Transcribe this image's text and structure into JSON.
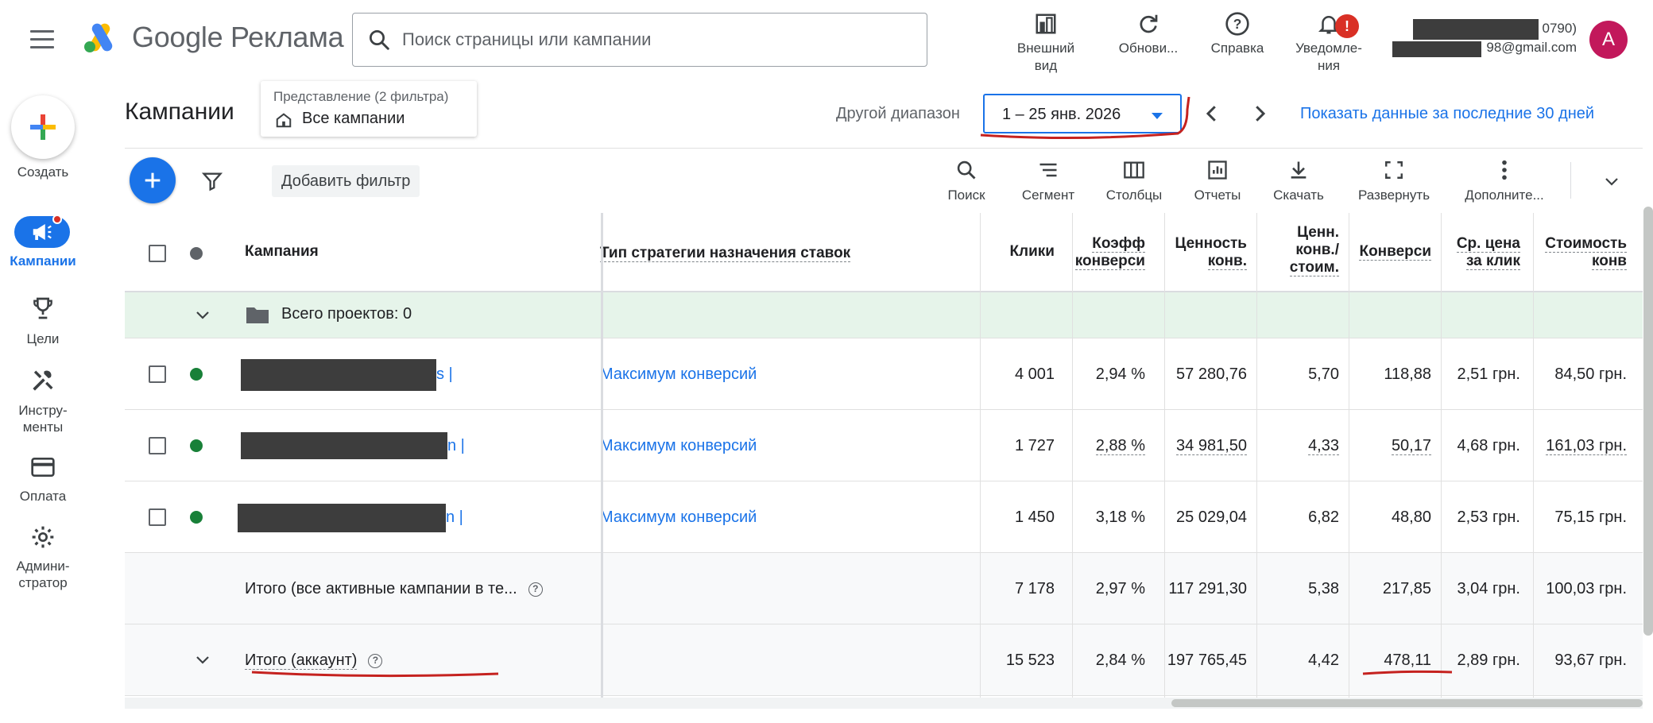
{
  "app": {
    "name": "Google Реклама",
    "search_placeholder": "Поиск страницы или кампании"
  },
  "top_actions": [
    {
      "label": "Внешний вид"
    },
    {
      "label": "Обнови..."
    },
    {
      "label": "Справка"
    },
    {
      "label": "Уведомле-ния",
      "badge": "!"
    }
  ],
  "account": {
    "id_tail": "0790)",
    "email_tail": "98@gmail.com",
    "avatar_letter": "A"
  },
  "rail": {
    "create": "Создать",
    "campaigns": "Кампании",
    "goals": "Цели",
    "tools": "Инстру-менты",
    "billing": "Оплата",
    "admin": "Админи-стратор"
  },
  "header": {
    "title": "Кампании",
    "view_label": "Представление (2 фильтра)",
    "view_value": "Все кампании",
    "range_label": "Другой диапазон",
    "date_range": "1 – 25 янв. 2026",
    "last30": "Показать данные за последние 30 дней"
  },
  "toolbar": {
    "add_filter": "Добавить фильтр",
    "tools": [
      "Поиск",
      "Сегмент",
      "Столбцы",
      "Отчеты",
      "Скачать",
      "Развернуть",
      "Дополните..."
    ]
  },
  "table": {
    "columns": {
      "campaign": "Кампания",
      "strategy": "Тип стратегии назначения ставок",
      "clicks": "Клики",
      "conv_rate_l1": "Коэфф",
      "conv_rate_l2": "конверси",
      "conv_value_l1": "Ценность",
      "conv_value_l2": "конв.",
      "value_cost_l1": "Ценн.",
      "value_cost_l2": "конв./",
      "value_cost_l3": "стоим.",
      "conversions": "Конверси",
      "avg_cpc_l1": "Ср. цена",
      "avg_cpc_l2": "за клик",
      "cost_conv_l1": "Стоимость",
      "cost_conv_l2": "конв"
    },
    "group_label": "Всего проектов: 0",
    "rows": [
      {
        "name_tail": "s |",
        "strategy": "Максимум конверсий",
        "clicks": "4 001",
        "conv_rate": "2,94 %",
        "conv_value": "57 280,76",
        "value_cost": "5,70",
        "conversions": "118,88",
        "avg_cpc": "2,51 грн.",
        "cost_conv": "84,50 грн."
      },
      {
        "name_tail": "n |",
        "strategy": "Максимум конверсий",
        "clicks": "1 727",
        "conv_rate": "2,88 %",
        "conv_value": "34 981,50",
        "value_cost": "4,33",
        "conversions": "50,17",
        "avg_cpc": "4,68 грн.",
        "cost_conv": "161,03 грн."
      },
      {
        "name_tail": "n |",
        "strategy": "Максимум конверсий",
        "clicks": "1 450",
        "conv_rate": "3,18 %",
        "conv_value": "25 029,04",
        "value_cost": "6,82",
        "conversions": "48,80",
        "avg_cpc": "2,53 грн.",
        "cost_conv": "75,15 грн."
      }
    ],
    "totals": [
      {
        "label": "Итого (все активные кампании в те...",
        "clicks": "7 178",
        "conv_rate": "2,97 %",
        "conv_value": "117 291,30",
        "value_cost": "5,38",
        "conversions": "217,85",
        "avg_cpc": "3,04 грн.",
        "cost_conv": "100,03 грн."
      },
      {
        "label": "Итого (аккаунт)",
        "clicks": "15 523",
        "conv_rate": "2,84 %",
        "conv_value": "197 765,45",
        "value_cost": "4,42",
        "conversions": "478,11",
        "avg_cpc": "2,89 грн.",
        "cost_conv": "93,67 грн."
      }
    ]
  },
  "colors": {
    "accent": "#1a73e8",
    "status_active": "#188038",
    "group_bg": "#e6f4ea",
    "annotation": "#c5221f"
  }
}
